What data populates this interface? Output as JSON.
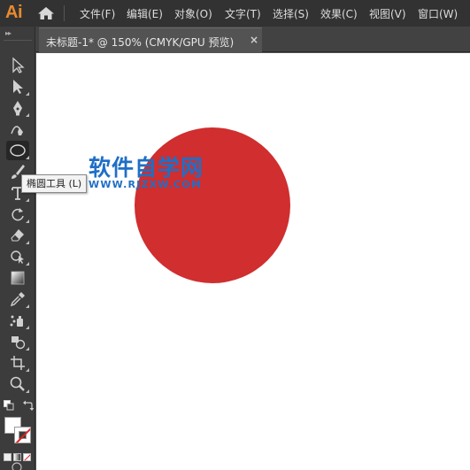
{
  "app": {
    "logo": "Ai"
  },
  "menu": {
    "items": [
      {
        "label": "文件(F)",
        "icon": "file-menu"
      },
      {
        "label": "编辑(E)",
        "icon": "edit-menu"
      },
      {
        "label": "对象(O)",
        "icon": "object-menu"
      },
      {
        "label": "文字(T)",
        "icon": "type-menu"
      },
      {
        "label": "选择(S)",
        "icon": "select-menu"
      },
      {
        "label": "效果(C)",
        "icon": "effect-menu"
      },
      {
        "label": "视图(V)",
        "icon": "view-menu"
      },
      {
        "label": "窗口(W)",
        "icon": "window-menu"
      }
    ]
  },
  "document": {
    "tab_title": "未标题-1* @ 150% (CMYK/GPU 预览)",
    "close_glyph": "×"
  },
  "tooltip": {
    "text": "椭圆工具 (L)"
  },
  "watermark": {
    "title": "软件自学网",
    "url": "WWW.RJZXW.COM"
  },
  "colors": {
    "circle_fill": "#d02e2f",
    "watermark": "#1f6fc6",
    "app_logo": "#e88a2e"
  },
  "tools": [
    {
      "name": "selection-tool",
      "active": false
    },
    {
      "name": "direct-selection-tool",
      "active": false
    },
    {
      "name": "pen-tool",
      "active": false
    },
    {
      "name": "curvature-tool",
      "active": false
    },
    {
      "name": "ellipse-tool",
      "active": true
    },
    {
      "name": "paintbrush-tool",
      "active": false
    },
    {
      "name": "type-tool",
      "active": false
    },
    {
      "name": "rotate-tool",
      "active": false
    },
    {
      "name": "eraser-tool",
      "active": false
    },
    {
      "name": "shape-builder-tool",
      "active": false
    },
    {
      "name": "gradient-tool",
      "active": false
    },
    {
      "name": "eyedropper-tool",
      "active": false
    },
    {
      "name": "symbol-sprayer-tool",
      "active": false
    },
    {
      "name": "live-paint-tool",
      "active": false
    },
    {
      "name": "artboard-tool",
      "active": false
    },
    {
      "name": "zoom-tool",
      "active": false
    }
  ]
}
